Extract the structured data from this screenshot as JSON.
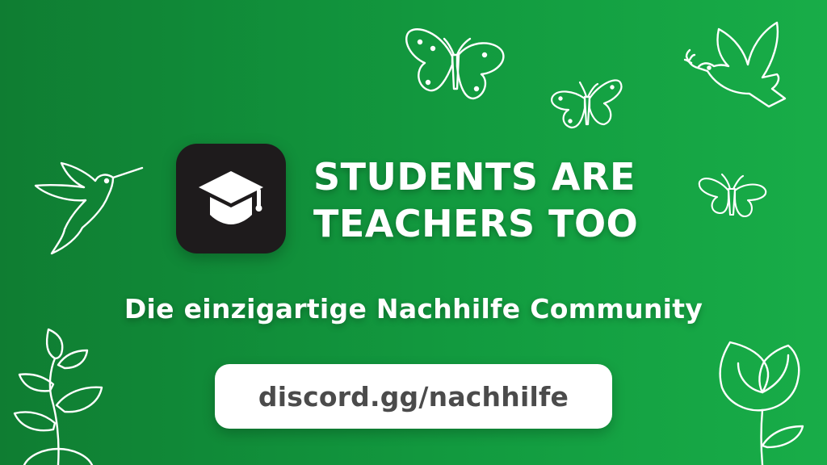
{
  "brand": {
    "colors": {
      "background_start": "#0f7d32",
      "background_end": "#18ad48",
      "icon_tile": "#1e1b1c",
      "text": "#ffffff",
      "pill": "#ffffff",
      "pill_text": "#4b4b4b"
    },
    "app_icon": "graduation-cap-icon"
  },
  "headline": {
    "line1": "STUDENTS ARE",
    "line2": "TEACHERS TOO"
  },
  "tagline": "Die einzigartige Nachhilfe Community",
  "invite": {
    "link_text": "discord.gg/nachhilfe"
  },
  "decorations": [
    "butterfly-icon",
    "dove-icon",
    "hummingbird-icon",
    "sprout-icon",
    "rose-icon"
  ]
}
